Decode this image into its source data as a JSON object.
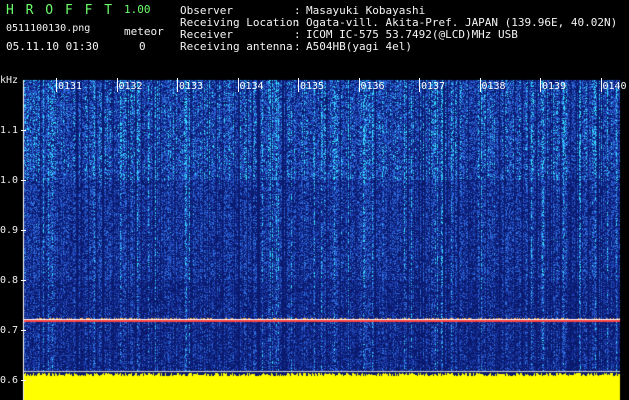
{
  "header": {
    "app_title": "H R O F F T",
    "version": "1.00",
    "filename": "0511100130.png",
    "meteor_label": "meteor",
    "datetime": "05.11.10 01:30",
    "meteor_count": "0"
  },
  "info": [
    {
      "key": "Observer",
      "sep": ":",
      "value": "Masayuki Kobayashi"
    },
    {
      "key": "Receiving Location",
      "sep": ":",
      "value": "Ogata-vill. Akita-Pref. JAPAN (139.96E, 40.02N)"
    },
    {
      "key": "Receiver",
      "sep": ":",
      "value": "ICOM IC-575 53.7492(@LCD)MHz USB"
    },
    {
      "key": "Receiving antenna",
      "sep": ":",
      "value": "A504HB(yagi 4el)"
    }
  ],
  "chart_data": {
    "type": "heatmap",
    "ylabel": "kHz",
    "y_ticks": [
      "1.1",
      "1.0",
      "0.9",
      "0.8",
      "0.7",
      "0.6"
    ],
    "ylim": [
      0.59,
      1.2
    ],
    "x_ticks": [
      "0131",
      "0132",
      "0133",
      "0134",
      "0135",
      "0136",
      "0137",
      "0138",
      "0139",
      "0140"
    ],
    "carrier_line_khz": 0.72,
    "colors": {
      "background": "#0a1a6e",
      "noise": "#2f6fe0",
      "noise_hot": "#35e0ff",
      "carrier": "#ff4040",
      "band": "#ffff00"
    }
  }
}
